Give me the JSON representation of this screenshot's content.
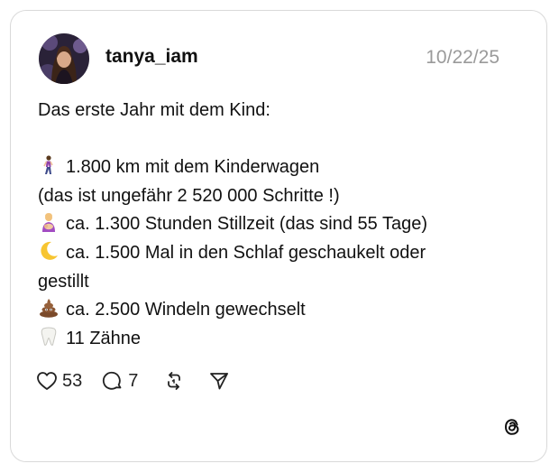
{
  "post": {
    "username": "tanya_iam",
    "date": "10/22/25",
    "lines": [
      "Das erste Jahr mit dem Kind:",
      "1.800 km mit dem Kinderwagen",
      "(das ist ungefähr 2 520 000 Schritte !)",
      "ca. 1.300 Stunden Stillzeit (das sind 55 Tage)",
      "ca. 1.500 Mal in den Schlaf geschaukelt oder",
      "gestillt",
      "ca. 2.500 Windeln gewechselt",
      "11 Zähne"
    ],
    "emoji_icons": [
      "person-walking-icon",
      "breastfeeding-icon",
      "crescent-moon-icon",
      "poop-icon",
      "tooth-icon"
    ]
  },
  "actions": {
    "likes": "53",
    "replies": "7"
  },
  "colors": {
    "card_border": "#d9d9d9",
    "date_text": "#9a9a9a",
    "text": "#111111"
  }
}
